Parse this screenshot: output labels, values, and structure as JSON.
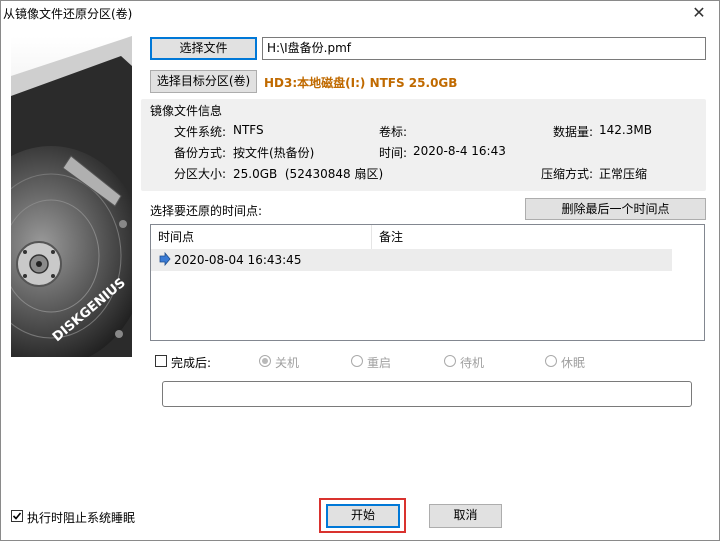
{
  "window": {
    "title": "从镜像文件还原分区(卷)",
    "close_glyph": "✕"
  },
  "banner": {
    "brand": "DISKGENIUS"
  },
  "source": {
    "select_file_label": "选择文件",
    "file_path": "H:\\I盘备份.pmf"
  },
  "target": {
    "select_target_label": "选择目标分区(卷)",
    "target_text": "HD3:本地磁盘(I:) NTFS 25.0GB",
    "target_color": "#c06a00"
  },
  "image_info": {
    "heading": "镜像文件信息",
    "fs_label": "文件系统:",
    "fs_value": "NTFS",
    "volume_label": "卷标:",
    "volume_value": "",
    "data_label": "数据量:",
    "data_value": "142.3MB",
    "backup_mode_label": "备份方式:",
    "backup_mode_value": "按文件(热备份)",
    "time_label": "时间:",
    "time_value": "2020-8-4 16:43",
    "size_label": "分区大小:",
    "size_value": "25.0GB  (52430848 扇区)",
    "compress_label": "压缩方式:",
    "compress_value": "正常压缩"
  },
  "timepoints": {
    "heading": "选择要还原的时间点:",
    "delete_label": "删除最后一个时间点",
    "columns": [
      "时间点",
      "备注"
    ],
    "rows": [
      {
        "time": "2020-08-04 16:43:45",
        "note": ""
      }
    ]
  },
  "after_complete": {
    "checkbox_label": "完成后:",
    "options": [
      "关机",
      "重启",
      "待机",
      "休眠"
    ],
    "selected": "关机"
  },
  "status_box": {
    "value": ""
  },
  "footer": {
    "prevent_sleep_label": "执行时阻止系统睡眠",
    "prevent_sleep_checked": true,
    "start_label": "开始",
    "cancel_label": "取消",
    "highlight_color": "#d9322e"
  }
}
